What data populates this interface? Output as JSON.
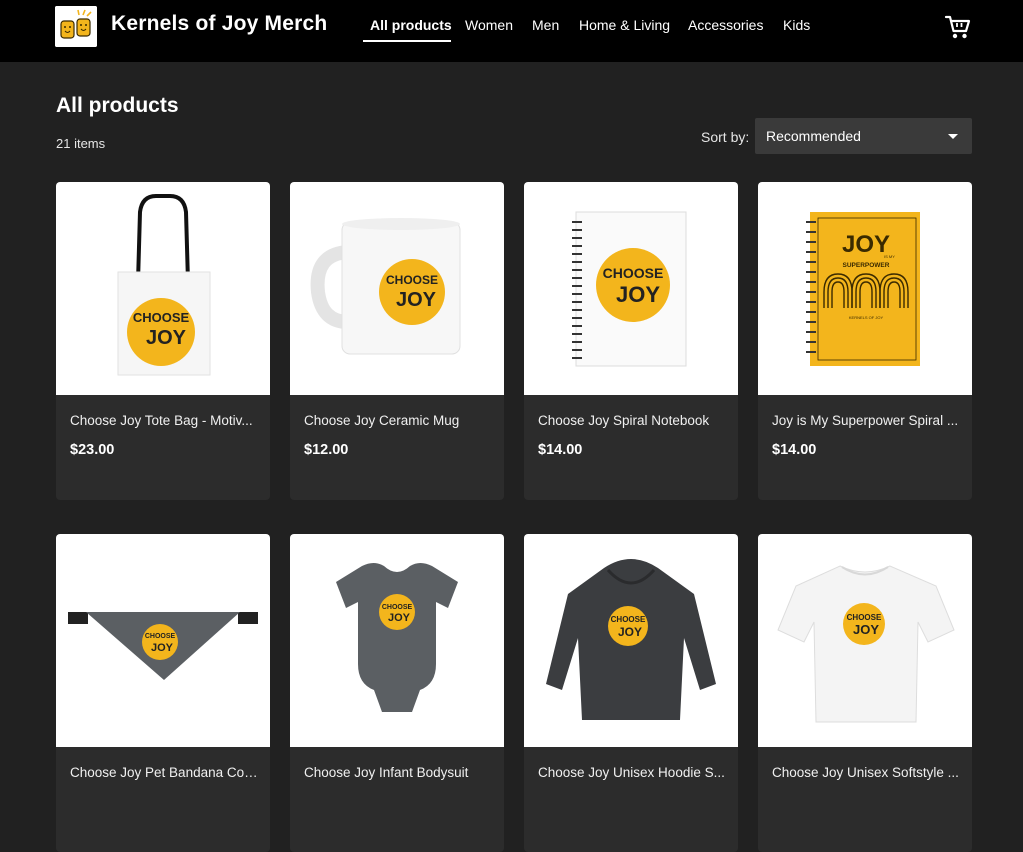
{
  "header": {
    "brand": "Kernels of Joy Merch",
    "nav": [
      {
        "label": "All products",
        "active": true
      },
      {
        "label": "Women",
        "active": false
      },
      {
        "label": "Men",
        "active": false
      },
      {
        "label": "Home & Living",
        "active": false
      },
      {
        "label": "Accessories",
        "active": false
      },
      {
        "label": "Kids",
        "active": false
      }
    ],
    "cart_icon": "cart-icon"
  },
  "main": {
    "title": "All products",
    "count": "21 items",
    "sort": {
      "label": "Sort by:",
      "value": "Recommended"
    }
  },
  "products": [
    {
      "name": "Choose Joy Tote Bag - Motiv...",
      "price": "$23.00",
      "image": "tote-bag"
    },
    {
      "name": "Choose Joy Ceramic Mug",
      "price": "$12.00",
      "image": "mug"
    },
    {
      "name": "Choose Joy Spiral Notebook",
      "price": "$14.00",
      "image": "notebook-white"
    },
    {
      "name": "Joy is My Superpower Spiral ...",
      "price": "$14.00",
      "image": "notebook-yellow"
    },
    {
      "name": "Choose Joy Pet Bandana Col...",
      "price": "",
      "image": "pet-bandana"
    },
    {
      "name": "Choose Joy Infant Bodysuit",
      "price": "",
      "image": "bodysuit"
    },
    {
      "name": "Choose Joy Unisex Hoodie S...",
      "price": "",
      "image": "hoodie"
    },
    {
      "name": "Choose Joy Unisex Softstyle ...",
      "price": "",
      "image": "tshirt"
    }
  ],
  "badge": {
    "line1": "CHOOSE",
    "line2": "JOY"
  },
  "superpower": {
    "title": "JOY",
    "subtitle": "SUPERPOWER",
    "small": "IS MY",
    "footer": "KERNELS OF JOY"
  },
  "colors": {
    "accent": "#f3b51c",
    "background": "#212121",
    "card": "#2c2c2c",
    "topbar": "#000000"
  }
}
